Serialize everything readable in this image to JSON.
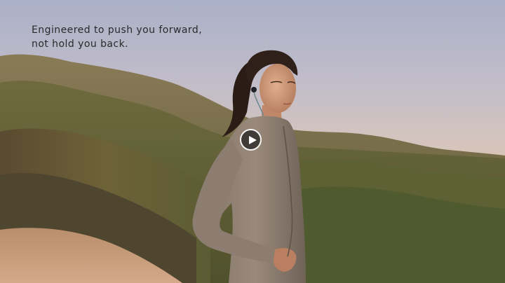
{
  "video": {
    "caption_lines": [
      "Engineered to push you forward,",
      "not hold you back."
    ],
    "play_button": {
      "icon": "play-icon",
      "state": "paused"
    }
  },
  "colors": {
    "caption_text": "#2a2a2c",
    "play_button_border": "#ffffff",
    "play_button_fill": "#28262480"
  }
}
